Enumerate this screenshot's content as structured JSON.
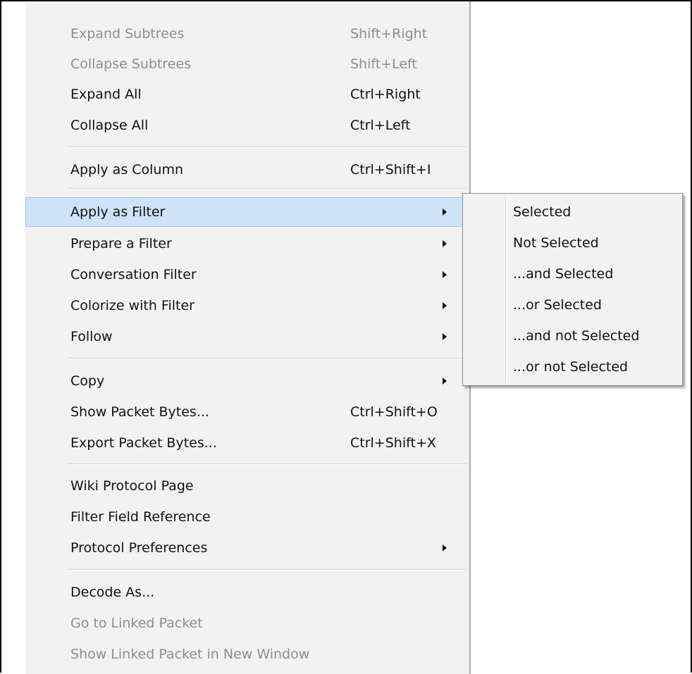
{
  "context_menu": {
    "items": [
      {
        "label": "Expand Subtrees",
        "shortcut": "Shift+Right",
        "disabled": true,
        "submenu": false
      },
      {
        "label": "Collapse Subtrees",
        "shortcut": "Shift+Left",
        "disabled": true,
        "submenu": false
      },
      {
        "label": "Expand All",
        "shortcut": "Ctrl+Right",
        "disabled": false,
        "submenu": false
      },
      {
        "label": "Collapse All",
        "shortcut": "Ctrl+Left",
        "disabled": false,
        "submenu": false
      },
      {
        "label": "Apply as Column",
        "shortcut": "Ctrl+Shift+I",
        "disabled": false,
        "submenu": false
      },
      {
        "label": "Apply as Filter",
        "shortcut": "",
        "disabled": false,
        "submenu": true,
        "highlighted": true
      },
      {
        "label": "Prepare a Filter",
        "shortcut": "",
        "disabled": false,
        "submenu": true
      },
      {
        "label": "Conversation Filter",
        "shortcut": "",
        "disabled": false,
        "submenu": true
      },
      {
        "label": "Colorize with Filter",
        "shortcut": "",
        "disabled": false,
        "submenu": true
      },
      {
        "label": "Follow",
        "shortcut": "",
        "disabled": false,
        "submenu": true
      },
      {
        "label": "Copy",
        "shortcut": "",
        "disabled": false,
        "submenu": true
      },
      {
        "label": "Show Packet Bytes...",
        "shortcut": "Ctrl+Shift+O",
        "disabled": false,
        "submenu": false
      },
      {
        "label": "Export Packet Bytes...",
        "shortcut": "Ctrl+Shift+X",
        "disabled": false,
        "submenu": false
      },
      {
        "label": "Wiki Protocol Page",
        "shortcut": "",
        "disabled": false,
        "submenu": false
      },
      {
        "label": "Filter Field Reference",
        "shortcut": "",
        "disabled": false,
        "submenu": false
      },
      {
        "label": "Protocol Preferences",
        "shortcut": "",
        "disabled": false,
        "submenu": true
      },
      {
        "label": "Decode As...",
        "shortcut": "",
        "disabled": false,
        "submenu": false
      },
      {
        "label": "Go to Linked Packet",
        "shortcut": "",
        "disabled": true,
        "submenu": false
      },
      {
        "label": "Show Linked Packet in New Window",
        "shortcut": "",
        "disabled": true,
        "submenu": false
      }
    ]
  },
  "apply_as_filter_submenu": {
    "items": [
      {
        "label": "Selected"
      },
      {
        "label": "Not Selected"
      },
      {
        "label": "...and Selected"
      },
      {
        "label": "...or Selected"
      },
      {
        "label": "...and not Selected"
      },
      {
        "label": "...or not Selected"
      }
    ]
  },
  "colors": {
    "menu_background": "#f2f2f2",
    "highlight_background": "#cde3f7",
    "highlight_border": "#99c6ee",
    "disabled_text": "#8d8d8d"
  },
  "icons": {
    "submenu_arrow": "submenu-arrow-icon"
  }
}
